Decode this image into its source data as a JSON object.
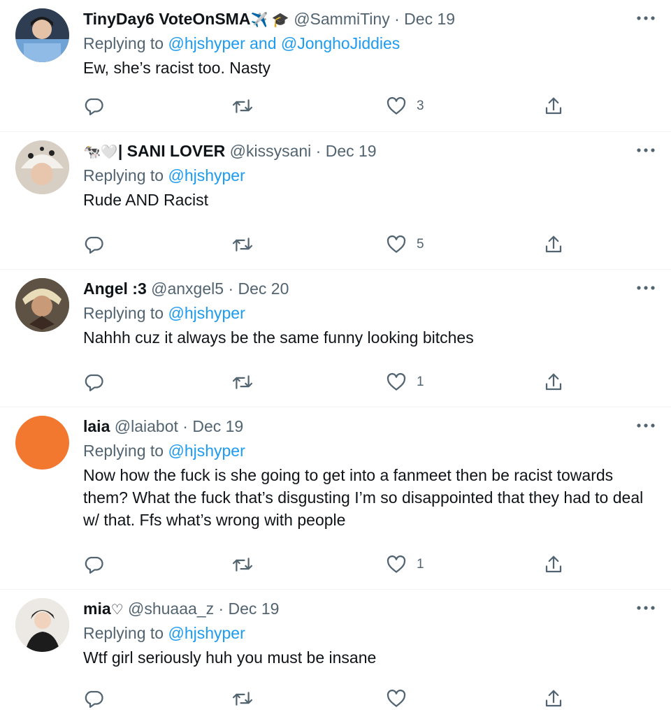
{
  "tweets": [
    {
      "name": "TinyDay6 VoteOnSMA",
      "name_emoji": "✈️ 🎓",
      "handle": "@SammiTiny",
      "sep": "·",
      "date": "Dec 19",
      "replying_prefix": "Replying to",
      "replying_to": "@hjshyper and @JonghoJiddies",
      "text": "Ew, she’s racist too. Nasty",
      "likes": "3",
      "avatar_color": "#6d8fb0"
    },
    {
      "name": "| SANI LOVER",
      "name_emoji": "🐄🤍",
      "handle": "@kissysani",
      "sep": "·",
      "date": "Dec 19",
      "replying_prefix": "Replying to",
      "replying_to": "@hjshyper",
      "text": "Rude AND Racist",
      "likes": "5",
      "avatar_color": "#c8b9a6"
    },
    {
      "name": "Angel :3",
      "name_emoji": "",
      "handle": "@anxgel5",
      "sep": "·",
      "date": "Dec 20",
      "replying_prefix": "Replying to",
      "replying_to": "@hjshyper",
      "text": "Nahhh cuz it always be the same funny looking bitches",
      "likes": "1",
      "avatar_color": "#8a7a62"
    },
    {
      "name": "laia",
      "name_emoji": "",
      "handle": "@laiabot",
      "sep": "·",
      "date": "Dec 19",
      "replying_prefix": "Replying to",
      "replying_to": "@hjshyper",
      "text": "Now how the fuck is she going to get into a fanmeet then be racist towards them? What the fuck that’s disgusting I’m so disappointed that they had to deal w/ that. Ffs what’s wrong with people",
      "likes": "1",
      "avatar_color": "#f2772f"
    },
    {
      "name": "mia",
      "name_emoji": "♡",
      "handle": "@shuaaa_z",
      "sep": "·",
      "date": "Dec 19",
      "replying_prefix": "Replying to",
      "replying_to": "@hjshyper",
      "text": "Wtf girl seriously huh you must be insane",
      "likes": "",
      "avatar_color": "#d9d4cf"
    }
  ],
  "colors": {
    "text": "#0f1419",
    "secondary": "#536471",
    "link": "#1d9bf0",
    "divider": "#eff3f4"
  },
  "icons": {
    "reply": "reply-icon",
    "retweet": "retweet-icon",
    "like": "heart-icon",
    "share": "share-icon",
    "more": "more-icon"
  }
}
